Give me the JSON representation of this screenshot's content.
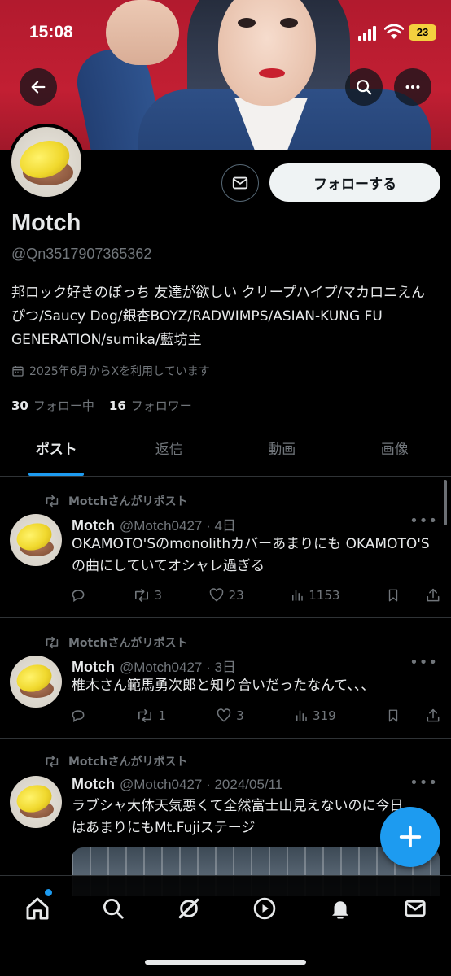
{
  "status_bar": {
    "time": "15:08",
    "battery": "23"
  },
  "profile": {
    "display_name": "Motch",
    "handle": "@Qn3517907365362",
    "bio": "邦ロック好きのぼっち 友達が欲しい クリープハイプ/マカロニえんぴつ/Saucy Dog/銀杏BOYZ/RADWIMPS/ASIAN-KUNG FU GENERATION/sumika/藍坊主",
    "joined": "2025年6月からXを利用しています",
    "following_count": "30",
    "following_label": "フォロー中",
    "followers_count": "16",
    "followers_label": "フォロワー",
    "follow_button": "フォローする"
  },
  "tabs": [
    {
      "label": "ポスト",
      "active": true
    },
    {
      "label": "返信",
      "active": false
    },
    {
      "label": "動画",
      "active": false
    },
    {
      "label": "画像",
      "active": false
    }
  ],
  "posts": [
    {
      "repost_label": "Motchさんがリポスト",
      "name": "Motch",
      "meta": "@Motch0427 · 4日",
      "text": "OKAMOTO'Sのmonolithカバーあまりにも OKAMOTO'Sの曲にしていてオシャレ過ぎる",
      "reposts": "3",
      "likes": "23",
      "views": "1153"
    },
    {
      "repost_label": "Motchさんがリポスト",
      "name": "Motch",
      "meta": "@Motch0427 · 3日",
      "text": "椎木さん範馬勇次郎と知り合いだったなんて、、、",
      "reposts": "1",
      "likes": "3",
      "views": "319"
    },
    {
      "repost_label": "Motchさんがリポスト",
      "name": "Motch",
      "meta": "@Motch0427 · 2024/05/11",
      "text": "ラブシャ大体天気悪くて全然富士山見えないのに今日はあまりにもMt.Fujiステージ"
    }
  ],
  "icons": {
    "back": "arrow-left-icon",
    "search": "search-icon",
    "more": "more-horizontal-icon",
    "mail": "envelope-icon",
    "calendar": "calendar-icon",
    "repost": "repost-icon",
    "reply": "reply-icon",
    "like": "heart-icon",
    "views": "bar-chart-icon",
    "bookmark": "bookmark-icon",
    "share": "share-icon",
    "compose": "plus-icon",
    "nav": [
      "home-icon",
      "search-icon",
      "grok-icon",
      "play-icon",
      "bell-icon",
      "envelope-icon"
    ]
  },
  "colors": {
    "accent": "#1d9bf0",
    "text": "#e7e9ea",
    "muted": "#71767b",
    "background": "#000000"
  }
}
